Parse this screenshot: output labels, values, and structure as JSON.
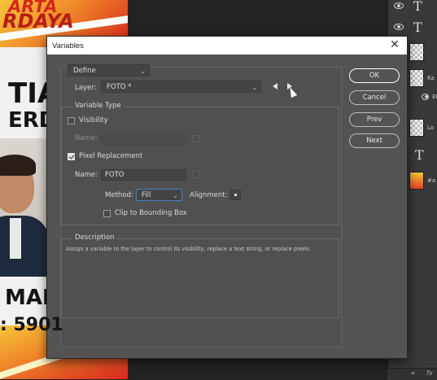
{
  "background": {
    "doc_line_1": "ARTA",
    "doc_line_2": "RDAYA",
    "doc_big_1": "TIA",
    "doc_big_2": "ERD",
    "doc_big_3": "MAN",
    "doc_big_4": ": 5901",
    "layers": [
      {
        "type": "text",
        "glyph": "T",
        "name": ""
      },
      {
        "type": "text",
        "glyph": "T",
        "name": ""
      },
      {
        "type": "image",
        "name": ""
      },
      {
        "type": "image",
        "name": "Ka"
      },
      {
        "type": "effect",
        "name": "Ef"
      },
      {
        "type": "image",
        "name": "Lo"
      },
      {
        "type": "text",
        "glyph": "T",
        "name": ""
      },
      {
        "type": "image",
        "name": "#a"
      }
    ],
    "fx_bar": {
      "link": "∞",
      "fx": "fx"
    }
  },
  "dialog": {
    "title": "Variables",
    "close_glyph": "✕",
    "define_select": "Define",
    "layer_label": "Layer:",
    "layer_value": "FOTO *",
    "variable_type_title": "Variable Type",
    "visibility_label": "Visibility",
    "visibility_checked": false,
    "visibility_name_label": "Name:",
    "visibility_name_value": "",
    "pixel_replacement_label": "Pixel Replacement",
    "pixel_replacement_checked": true,
    "pixel_name_label": "Name:",
    "pixel_name_value": "FOTO",
    "method_label": "Method:",
    "method_value": "Fill",
    "alignment_label": "Alignment:",
    "clip_label": "Clip to Bounding Box",
    "clip_checked": false,
    "description_title": "Description",
    "description_text": "Assign a variable to the layer to control its visibility, replace a text string, or replace pixels.",
    "buttons": {
      "ok": "OK",
      "cancel": "Cancel",
      "prev": "Prev",
      "next": "Next"
    }
  }
}
